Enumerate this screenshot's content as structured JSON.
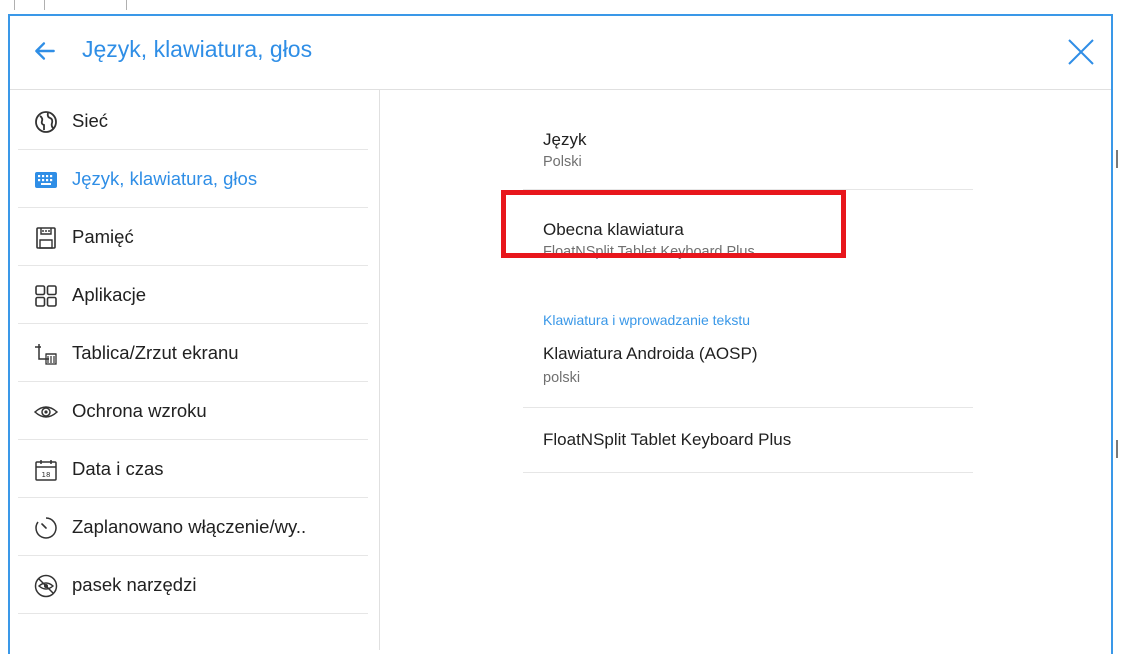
{
  "header": {
    "title": "Język, klawiatura, głos",
    "back_icon": "arrow-left-icon",
    "close_icon": "close-icon"
  },
  "colors": {
    "accent": "#2f8ee6",
    "frame": "#3a98e8",
    "highlight": "#e8161c",
    "divider": "#e6e6e6"
  },
  "sidebar": {
    "items": [
      {
        "label": "Sieć",
        "icon": "globe-icon",
        "active": false
      },
      {
        "label": "Język, klawiatura, głos",
        "icon": "keyboard-icon",
        "active": true
      },
      {
        "label": "Pamięć",
        "icon": "storage-icon",
        "active": false
      },
      {
        "label": "Aplikacje",
        "icon": "apps-grid-icon",
        "active": false
      },
      {
        "label": "Tablica/Zrzut ekranu",
        "icon": "whiteboard-screenshot-icon",
        "active": false
      },
      {
        "label": "Ochrona wzroku",
        "icon": "eye-icon",
        "active": false
      },
      {
        "label": "Data i czas",
        "icon": "calendar-icon",
        "active": false
      },
      {
        "label": "Zaplanowano włączenie/wy..",
        "icon": "timer-icon",
        "active": false
      },
      {
        "label": "pasek narzędzi",
        "icon": "toolbar-hidden-icon",
        "active": false
      }
    ]
  },
  "main": {
    "language": {
      "title": "Język",
      "summary": "Polski"
    },
    "current_keyboard": {
      "title": "Obecna klawiatura",
      "summary": "FloatNSplit Tablet Keyboard Plus"
    },
    "category_label": "Klawiatura i wprowadzanie tekstu",
    "keyboards": [
      {
        "title": "Klawiatura Androida (AOSP)",
        "summary": "polski"
      },
      {
        "title": "FloatNSplit Tablet Keyboard Plus",
        "summary": ""
      }
    ]
  }
}
